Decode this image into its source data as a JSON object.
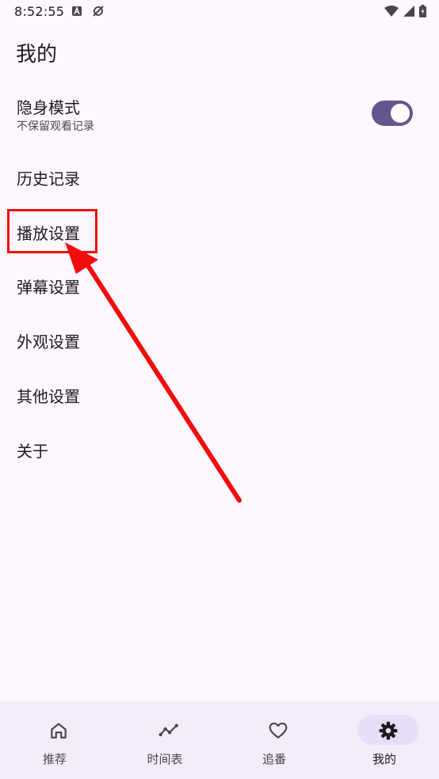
{
  "status_bar": {
    "time": "8:52:55",
    "icons": [
      "notification-a-icon",
      "no-sync-icon",
      "wifi-icon",
      "signal-icon",
      "battery-icon"
    ]
  },
  "page": {
    "title": "我的"
  },
  "settings": {
    "incognito": {
      "label": "隐身模式",
      "sublabel": "不保留观看记录",
      "enabled": true
    },
    "items": [
      {
        "label": "历史记录"
      },
      {
        "label": "播放设置"
      },
      {
        "label": "弹幕设置"
      },
      {
        "label": "外观设置"
      },
      {
        "label": "其他设置"
      },
      {
        "label": "关于"
      }
    ]
  },
  "bottom_nav": {
    "items": [
      {
        "label": "推荐",
        "icon": "home-icon",
        "active": false
      },
      {
        "label": "时间表",
        "icon": "timeline-icon",
        "active": false
      },
      {
        "label": "追番",
        "icon": "heart-icon",
        "active": false
      },
      {
        "label": "我的",
        "icon": "gear-icon",
        "active": true
      }
    ]
  },
  "colors": {
    "background": "#fef7ff",
    "accent": "#65558f",
    "nav_background": "#f3edf7",
    "active_pill": "#e8def8",
    "annotation": "#f20c0c"
  }
}
